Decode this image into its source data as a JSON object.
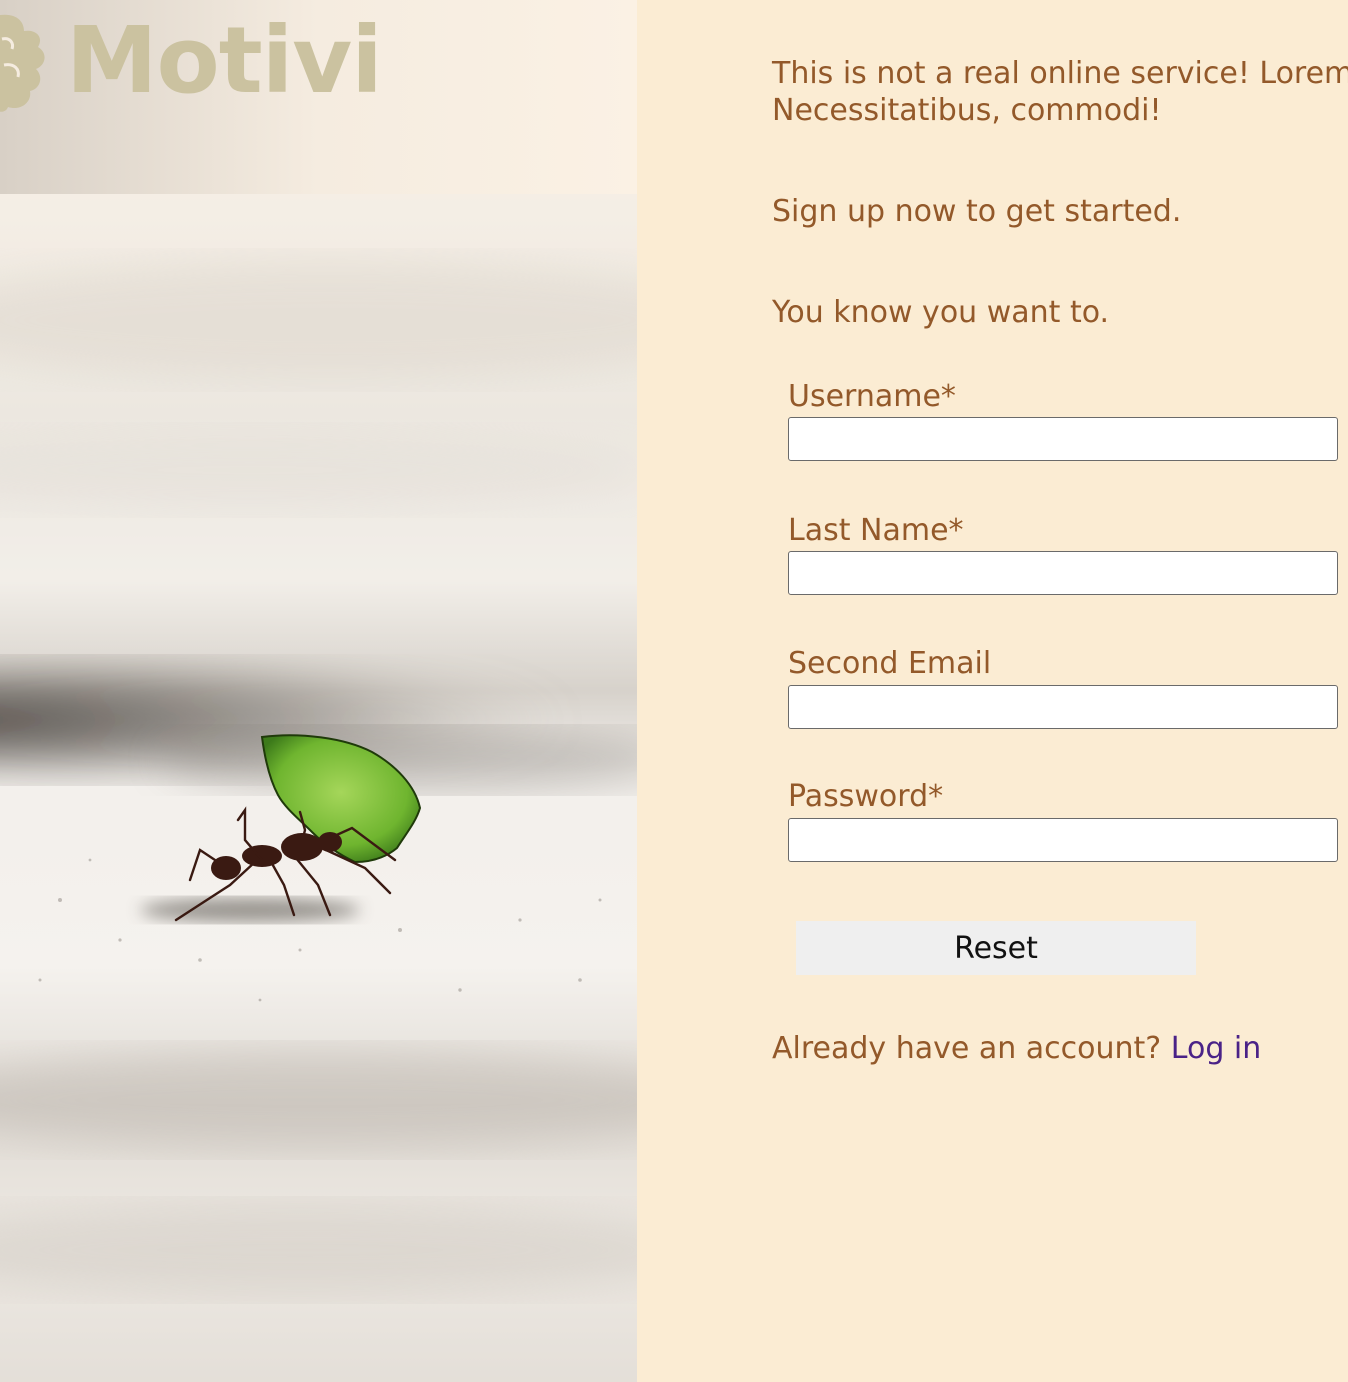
{
  "brand": {
    "name": "Motivi",
    "logo_icon": "brain-icon",
    "color": "#cbc2a0"
  },
  "hero": {
    "image": "leaf-cutter-ant-photo"
  },
  "intro": {
    "notice_line1": "This is not a real online service! Lorem",
    "notice_line2": "Necessitatibus, commodi!",
    "signup_prompt": "Sign up now to get started.",
    "motivation": "You know you want to."
  },
  "form": {
    "fields": [
      {
        "label": "Username*",
        "value": ""
      },
      {
        "label": "Last Name*",
        "value": ""
      },
      {
        "label": "Second Email",
        "value": ""
      },
      {
        "label": "Password*",
        "value": ""
      }
    ],
    "reset_label": "Reset"
  },
  "footer": {
    "account_prompt": "Already have an account?",
    "login_label": "Log in"
  },
  "colors": {
    "panel_background": "#fbecd3",
    "text": "#93592a",
    "link": "#4a2287",
    "button_background": "#efefef"
  }
}
